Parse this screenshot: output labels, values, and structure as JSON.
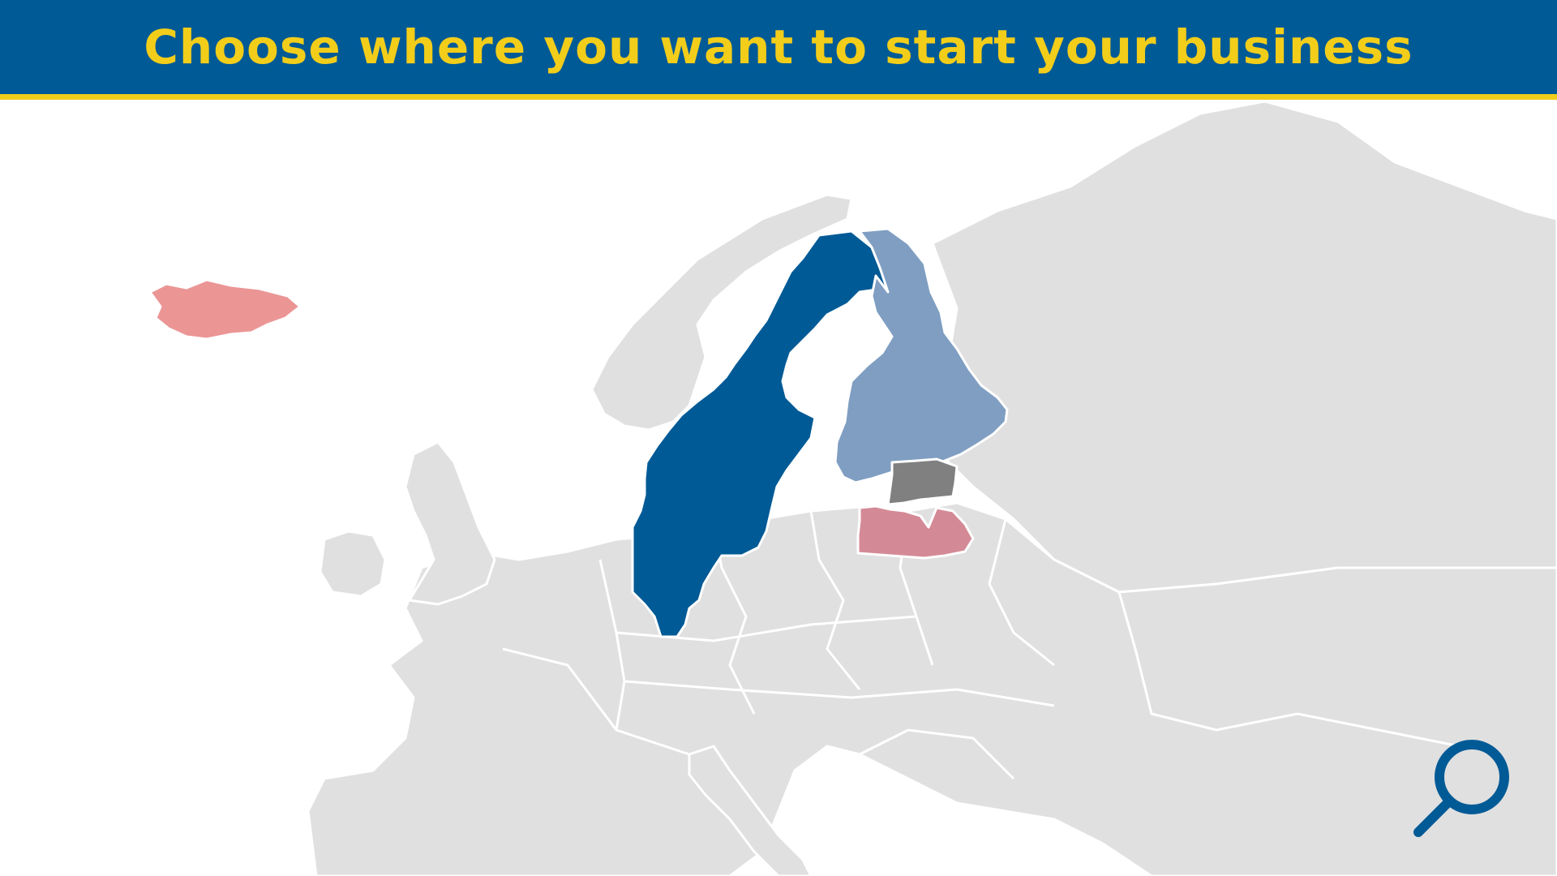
{
  "header": {
    "title": "Choose where you want to start your business"
  },
  "map": {
    "base_color": "#e0e0e0",
    "border_color": "#ffffff",
    "highlighted_countries": [
      {
        "name": "Iceland",
        "color": "#eb9595"
      },
      {
        "name": "Sweden",
        "color": "#005a96"
      },
      {
        "name": "Finland",
        "color": "#7f9ec2"
      },
      {
        "name": "Estonia",
        "color": "#808080"
      },
      {
        "name": "Latvia",
        "color": "#d48a96"
      }
    ]
  },
  "search": {
    "icon": "magnifier-icon",
    "color": "#005a96"
  },
  "theme": {
    "primary": "#005a96",
    "accent": "#f2cd1a"
  }
}
